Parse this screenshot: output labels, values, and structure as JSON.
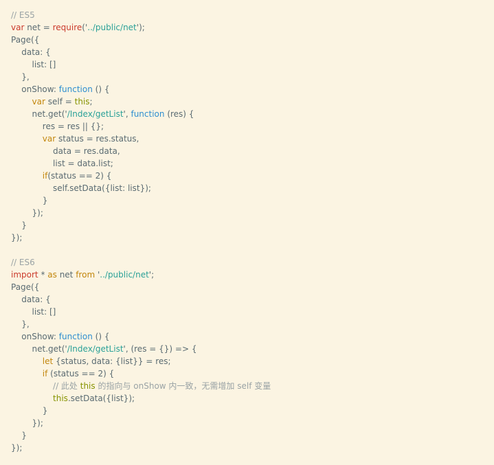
{
  "colors": {
    "background": "#fbf4e2",
    "text": "#5a6b72",
    "keyword": "#c2860c",
    "comment": "#9aa3a5",
    "function": "#2f8fd0",
    "string": "#2aa198",
    "red": "#cb3b2c",
    "olive": "#869300"
  },
  "code_lines": [
    [
      {
        "t": "cmt",
        "v": "// ES5"
      }
    ],
    [
      {
        "t": "red",
        "v": "var"
      },
      {
        "t": "plain",
        "v": " net = "
      },
      {
        "t": "red",
        "v": "require"
      },
      {
        "t": "plain",
        "v": "('"
      },
      {
        "t": "str",
        "v": "../public/net"
      },
      {
        "t": "plain",
        "v": "');"
      }
    ],
    [
      {
        "t": "plain",
        "v": "Page({"
      }
    ],
    [
      {
        "t": "plain",
        "v": "    data: {"
      }
    ],
    [
      {
        "t": "plain",
        "v": "        list: []"
      }
    ],
    [
      {
        "t": "plain",
        "v": "    },"
      }
    ],
    [
      {
        "t": "plain",
        "v": "    onShow: "
      },
      {
        "t": "fn",
        "v": "function"
      },
      {
        "t": "plain",
        "v": " () {"
      }
    ],
    [
      {
        "t": "plain",
        "v": "        "
      },
      {
        "t": "kw",
        "v": "var"
      },
      {
        "t": "plain",
        "v": " self = "
      },
      {
        "t": "olive",
        "v": "this"
      },
      {
        "t": "plain",
        "v": ";"
      }
    ],
    [
      {
        "t": "plain",
        "v": "        net.get('"
      },
      {
        "t": "str",
        "v": "/Index/getList"
      },
      {
        "t": "plain",
        "v": "', "
      },
      {
        "t": "fn",
        "v": "function"
      },
      {
        "t": "plain",
        "v": " (res) {"
      }
    ],
    [
      {
        "t": "plain",
        "v": "            res = res || {};"
      }
    ],
    [
      {
        "t": "plain",
        "v": "            "
      },
      {
        "t": "kw",
        "v": "var"
      },
      {
        "t": "plain",
        "v": " status = res.status,"
      }
    ],
    [
      {
        "t": "plain",
        "v": "                data = res.data,"
      }
    ],
    [
      {
        "t": "plain",
        "v": "                list = data.list;"
      }
    ],
    [
      {
        "t": "plain",
        "v": "            "
      },
      {
        "t": "kw",
        "v": "if"
      },
      {
        "t": "plain",
        "v": "(status == 2) {"
      }
    ],
    [
      {
        "t": "plain",
        "v": "                self.setData({list: list});"
      }
    ],
    [
      {
        "t": "plain",
        "v": "            }"
      }
    ],
    [
      {
        "t": "plain",
        "v": "        });"
      }
    ],
    [
      {
        "t": "plain",
        "v": "    }"
      }
    ],
    [
      {
        "t": "plain",
        "v": "});"
      }
    ],
    [],
    [
      {
        "t": "cmt",
        "v": "// ES6"
      }
    ],
    [
      {
        "t": "red",
        "v": "import"
      },
      {
        "t": "plain",
        "v": " * "
      },
      {
        "t": "kw",
        "v": "as"
      },
      {
        "t": "plain",
        "v": " net "
      },
      {
        "t": "kw",
        "v": "from"
      },
      {
        "t": "plain",
        "v": " '"
      },
      {
        "t": "str",
        "v": "../public/net"
      },
      {
        "t": "plain",
        "v": "';"
      }
    ],
    [
      {
        "t": "plain",
        "v": "Page({"
      }
    ],
    [
      {
        "t": "plain",
        "v": "    data: {"
      }
    ],
    [
      {
        "t": "plain",
        "v": "        list: []"
      }
    ],
    [
      {
        "t": "plain",
        "v": "    },"
      }
    ],
    [
      {
        "t": "plain",
        "v": "    onShow: "
      },
      {
        "t": "fn",
        "v": "function"
      },
      {
        "t": "plain",
        "v": " () {"
      }
    ],
    [
      {
        "t": "plain",
        "v": "        net.get('"
      },
      {
        "t": "str",
        "v": "/Index/getList"
      },
      {
        "t": "plain",
        "v": "', (res = {}) => {"
      }
    ],
    [
      {
        "t": "plain",
        "v": "            "
      },
      {
        "t": "kw",
        "v": "let"
      },
      {
        "t": "plain",
        "v": " {status, data: {list}} = res;"
      }
    ],
    [
      {
        "t": "plain",
        "v": "            "
      },
      {
        "t": "kw",
        "v": "if"
      },
      {
        "t": "plain",
        "v": " (status == 2) {"
      }
    ],
    [
      {
        "t": "plain",
        "v": "                "
      },
      {
        "t": "cmt",
        "v": "// 此处 "
      },
      {
        "t": "olive",
        "v": "this"
      },
      {
        "t": "cmt",
        "v": " 的指向与 onShow 内一致，无需增加 self 变量"
      }
    ],
    [
      {
        "t": "plain",
        "v": "                "
      },
      {
        "t": "olive",
        "v": "this"
      },
      {
        "t": "plain",
        "v": ".setData({list});"
      }
    ],
    [
      {
        "t": "plain",
        "v": "            }"
      }
    ],
    [
      {
        "t": "plain",
        "v": "        });"
      }
    ],
    [
      {
        "t": "plain",
        "v": "    }"
      }
    ],
    [
      {
        "t": "plain",
        "v": "});"
      }
    ]
  ]
}
